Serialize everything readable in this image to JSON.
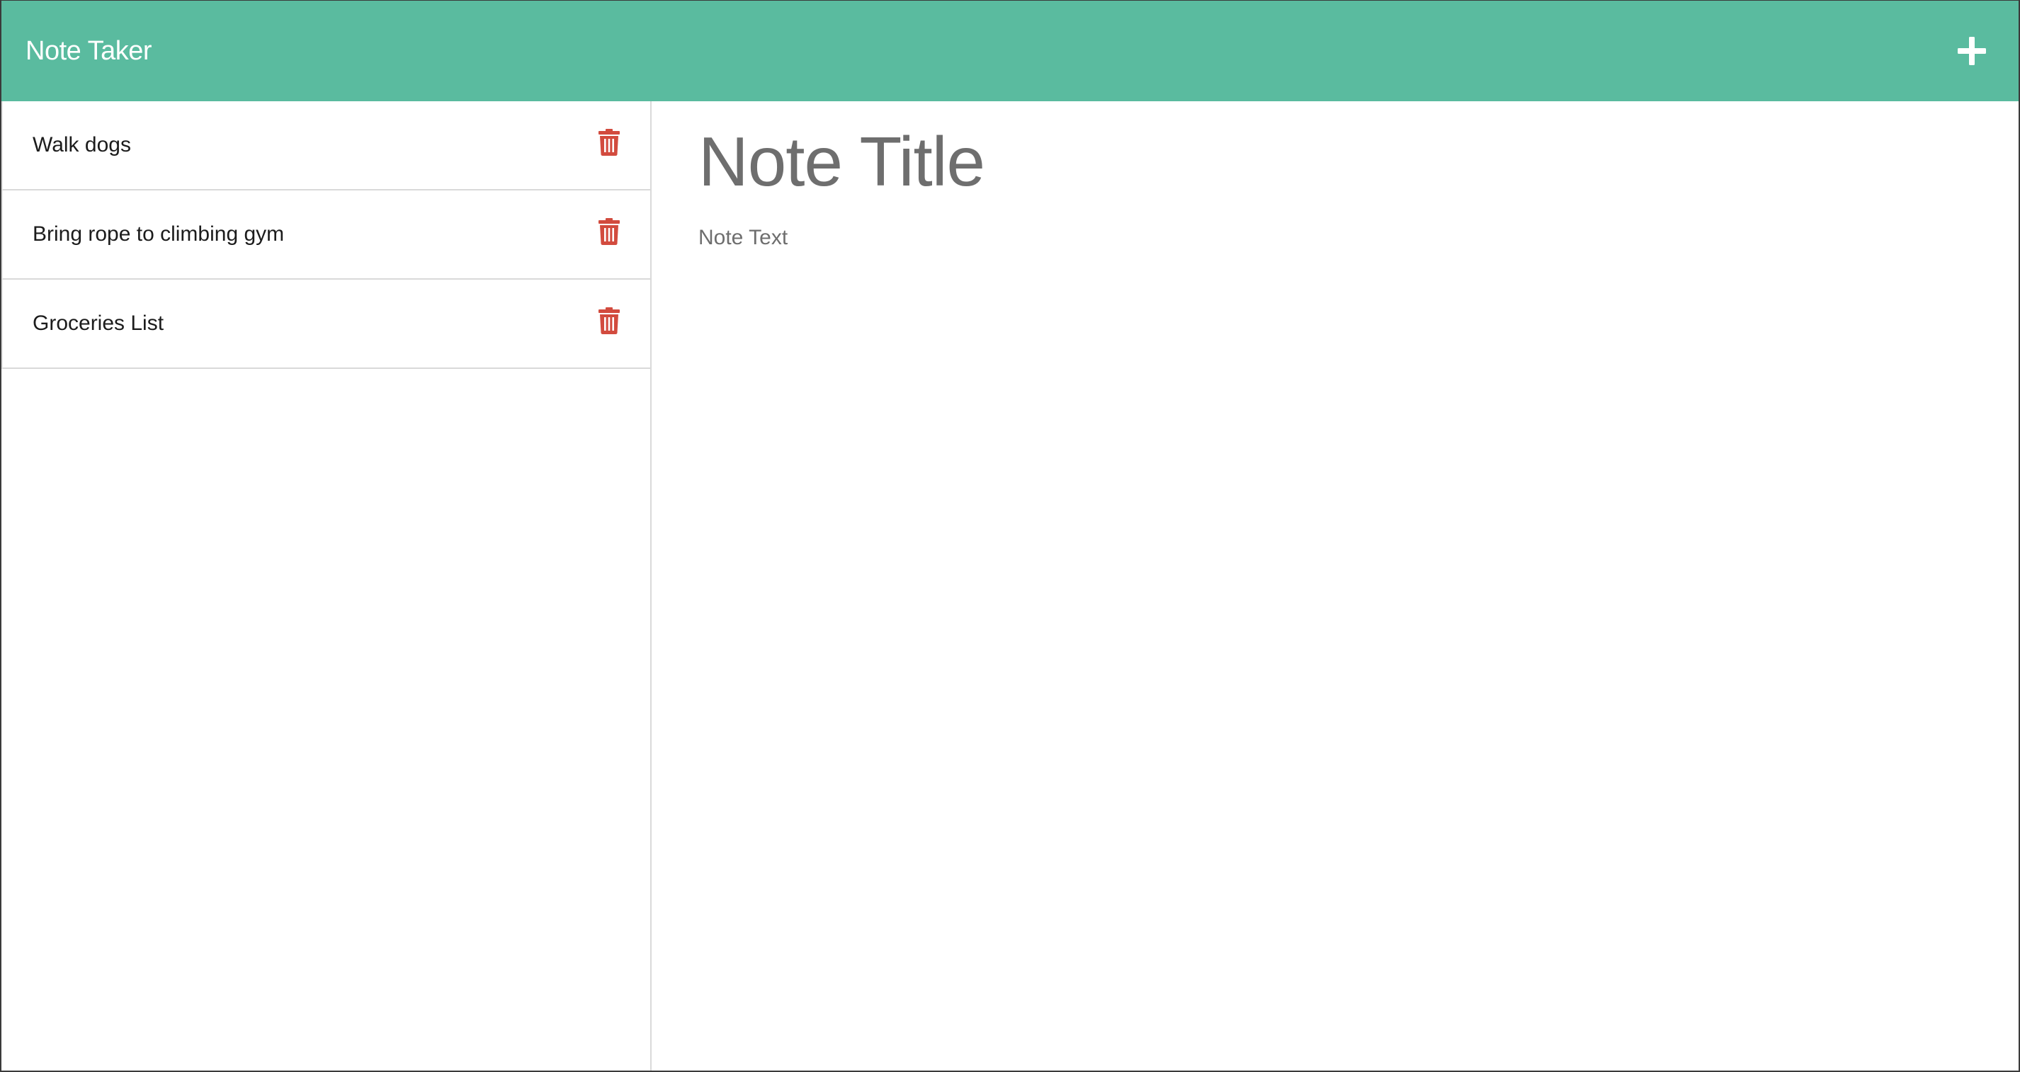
{
  "app": {
    "title": "Note Taker"
  },
  "header": {
    "add_icon": "plus-icon"
  },
  "sidebar": {
    "notes": [
      {
        "label": "Walk dogs",
        "icon": "trash-icon"
      },
      {
        "label": "Bring rope to climbing gym",
        "icon": "trash-icon"
      },
      {
        "label": "Groceries List",
        "icon": "trash-icon"
      }
    ]
  },
  "editor": {
    "title_placeholder": "Note Title",
    "title_value": "",
    "text_placeholder": "Note Text",
    "text_value": ""
  },
  "colors": {
    "header_bg": "#5abb9f",
    "trash_icon": "#d24b3e",
    "placeholder_text": "#6e6e6e"
  }
}
